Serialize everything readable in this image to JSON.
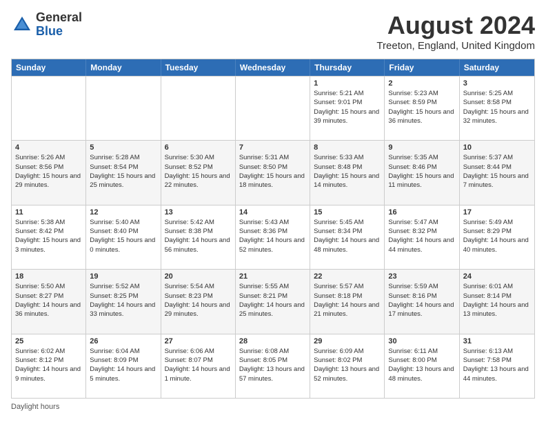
{
  "header": {
    "logo_general": "General",
    "logo_blue": "Blue",
    "month_title": "August 2024",
    "location": "Treeton, England, United Kingdom"
  },
  "days_of_week": [
    "Sunday",
    "Monday",
    "Tuesday",
    "Wednesday",
    "Thursday",
    "Friday",
    "Saturday"
  ],
  "footer": "Daylight hours",
  "weeks": [
    [
      {
        "day": "",
        "sunrise": "",
        "sunset": "",
        "daylight": ""
      },
      {
        "day": "",
        "sunrise": "",
        "sunset": "",
        "daylight": ""
      },
      {
        "day": "",
        "sunrise": "",
        "sunset": "",
        "daylight": ""
      },
      {
        "day": "",
        "sunrise": "",
        "sunset": "",
        "daylight": ""
      },
      {
        "day": "1",
        "sunrise": "Sunrise: 5:21 AM",
        "sunset": "Sunset: 9:01 PM",
        "daylight": "Daylight: 15 hours and 39 minutes."
      },
      {
        "day": "2",
        "sunrise": "Sunrise: 5:23 AM",
        "sunset": "Sunset: 8:59 PM",
        "daylight": "Daylight: 15 hours and 36 minutes."
      },
      {
        "day": "3",
        "sunrise": "Sunrise: 5:25 AM",
        "sunset": "Sunset: 8:58 PM",
        "daylight": "Daylight: 15 hours and 32 minutes."
      }
    ],
    [
      {
        "day": "4",
        "sunrise": "Sunrise: 5:26 AM",
        "sunset": "Sunset: 8:56 PM",
        "daylight": "Daylight: 15 hours and 29 minutes."
      },
      {
        "day": "5",
        "sunrise": "Sunrise: 5:28 AM",
        "sunset": "Sunset: 8:54 PM",
        "daylight": "Daylight: 15 hours and 25 minutes."
      },
      {
        "day": "6",
        "sunrise": "Sunrise: 5:30 AM",
        "sunset": "Sunset: 8:52 PM",
        "daylight": "Daylight: 15 hours and 22 minutes."
      },
      {
        "day": "7",
        "sunrise": "Sunrise: 5:31 AM",
        "sunset": "Sunset: 8:50 PM",
        "daylight": "Daylight: 15 hours and 18 minutes."
      },
      {
        "day": "8",
        "sunrise": "Sunrise: 5:33 AM",
        "sunset": "Sunset: 8:48 PM",
        "daylight": "Daylight: 15 hours and 14 minutes."
      },
      {
        "day": "9",
        "sunrise": "Sunrise: 5:35 AM",
        "sunset": "Sunset: 8:46 PM",
        "daylight": "Daylight: 15 hours and 11 minutes."
      },
      {
        "day": "10",
        "sunrise": "Sunrise: 5:37 AM",
        "sunset": "Sunset: 8:44 PM",
        "daylight": "Daylight: 15 hours and 7 minutes."
      }
    ],
    [
      {
        "day": "11",
        "sunrise": "Sunrise: 5:38 AM",
        "sunset": "Sunset: 8:42 PM",
        "daylight": "Daylight: 15 hours and 3 minutes."
      },
      {
        "day": "12",
        "sunrise": "Sunrise: 5:40 AM",
        "sunset": "Sunset: 8:40 PM",
        "daylight": "Daylight: 15 hours and 0 minutes."
      },
      {
        "day": "13",
        "sunrise": "Sunrise: 5:42 AM",
        "sunset": "Sunset: 8:38 PM",
        "daylight": "Daylight: 14 hours and 56 minutes."
      },
      {
        "day": "14",
        "sunrise": "Sunrise: 5:43 AM",
        "sunset": "Sunset: 8:36 PM",
        "daylight": "Daylight: 14 hours and 52 minutes."
      },
      {
        "day": "15",
        "sunrise": "Sunrise: 5:45 AM",
        "sunset": "Sunset: 8:34 PM",
        "daylight": "Daylight: 14 hours and 48 minutes."
      },
      {
        "day": "16",
        "sunrise": "Sunrise: 5:47 AM",
        "sunset": "Sunset: 8:32 PM",
        "daylight": "Daylight: 14 hours and 44 minutes."
      },
      {
        "day": "17",
        "sunrise": "Sunrise: 5:49 AM",
        "sunset": "Sunset: 8:29 PM",
        "daylight": "Daylight: 14 hours and 40 minutes."
      }
    ],
    [
      {
        "day": "18",
        "sunrise": "Sunrise: 5:50 AM",
        "sunset": "Sunset: 8:27 PM",
        "daylight": "Daylight: 14 hours and 36 minutes."
      },
      {
        "day": "19",
        "sunrise": "Sunrise: 5:52 AM",
        "sunset": "Sunset: 8:25 PM",
        "daylight": "Daylight: 14 hours and 33 minutes."
      },
      {
        "day": "20",
        "sunrise": "Sunrise: 5:54 AM",
        "sunset": "Sunset: 8:23 PM",
        "daylight": "Daylight: 14 hours and 29 minutes."
      },
      {
        "day": "21",
        "sunrise": "Sunrise: 5:55 AM",
        "sunset": "Sunset: 8:21 PM",
        "daylight": "Daylight: 14 hours and 25 minutes."
      },
      {
        "day": "22",
        "sunrise": "Sunrise: 5:57 AM",
        "sunset": "Sunset: 8:18 PM",
        "daylight": "Daylight: 14 hours and 21 minutes."
      },
      {
        "day": "23",
        "sunrise": "Sunrise: 5:59 AM",
        "sunset": "Sunset: 8:16 PM",
        "daylight": "Daylight: 14 hours and 17 minutes."
      },
      {
        "day": "24",
        "sunrise": "Sunrise: 6:01 AM",
        "sunset": "Sunset: 8:14 PM",
        "daylight": "Daylight: 14 hours and 13 minutes."
      }
    ],
    [
      {
        "day": "25",
        "sunrise": "Sunrise: 6:02 AM",
        "sunset": "Sunset: 8:12 PM",
        "daylight": "Daylight: 14 hours and 9 minutes."
      },
      {
        "day": "26",
        "sunrise": "Sunrise: 6:04 AM",
        "sunset": "Sunset: 8:09 PM",
        "daylight": "Daylight: 14 hours and 5 minutes."
      },
      {
        "day": "27",
        "sunrise": "Sunrise: 6:06 AM",
        "sunset": "Sunset: 8:07 PM",
        "daylight": "Daylight: 14 hours and 1 minute."
      },
      {
        "day": "28",
        "sunrise": "Sunrise: 6:08 AM",
        "sunset": "Sunset: 8:05 PM",
        "daylight": "Daylight: 13 hours and 57 minutes."
      },
      {
        "day": "29",
        "sunrise": "Sunrise: 6:09 AM",
        "sunset": "Sunset: 8:02 PM",
        "daylight": "Daylight: 13 hours and 52 minutes."
      },
      {
        "day": "30",
        "sunrise": "Sunrise: 6:11 AM",
        "sunset": "Sunset: 8:00 PM",
        "daylight": "Daylight: 13 hours and 48 minutes."
      },
      {
        "day": "31",
        "sunrise": "Sunrise: 6:13 AM",
        "sunset": "Sunset: 7:58 PM",
        "daylight": "Daylight: 13 hours and 44 minutes."
      }
    ]
  ]
}
